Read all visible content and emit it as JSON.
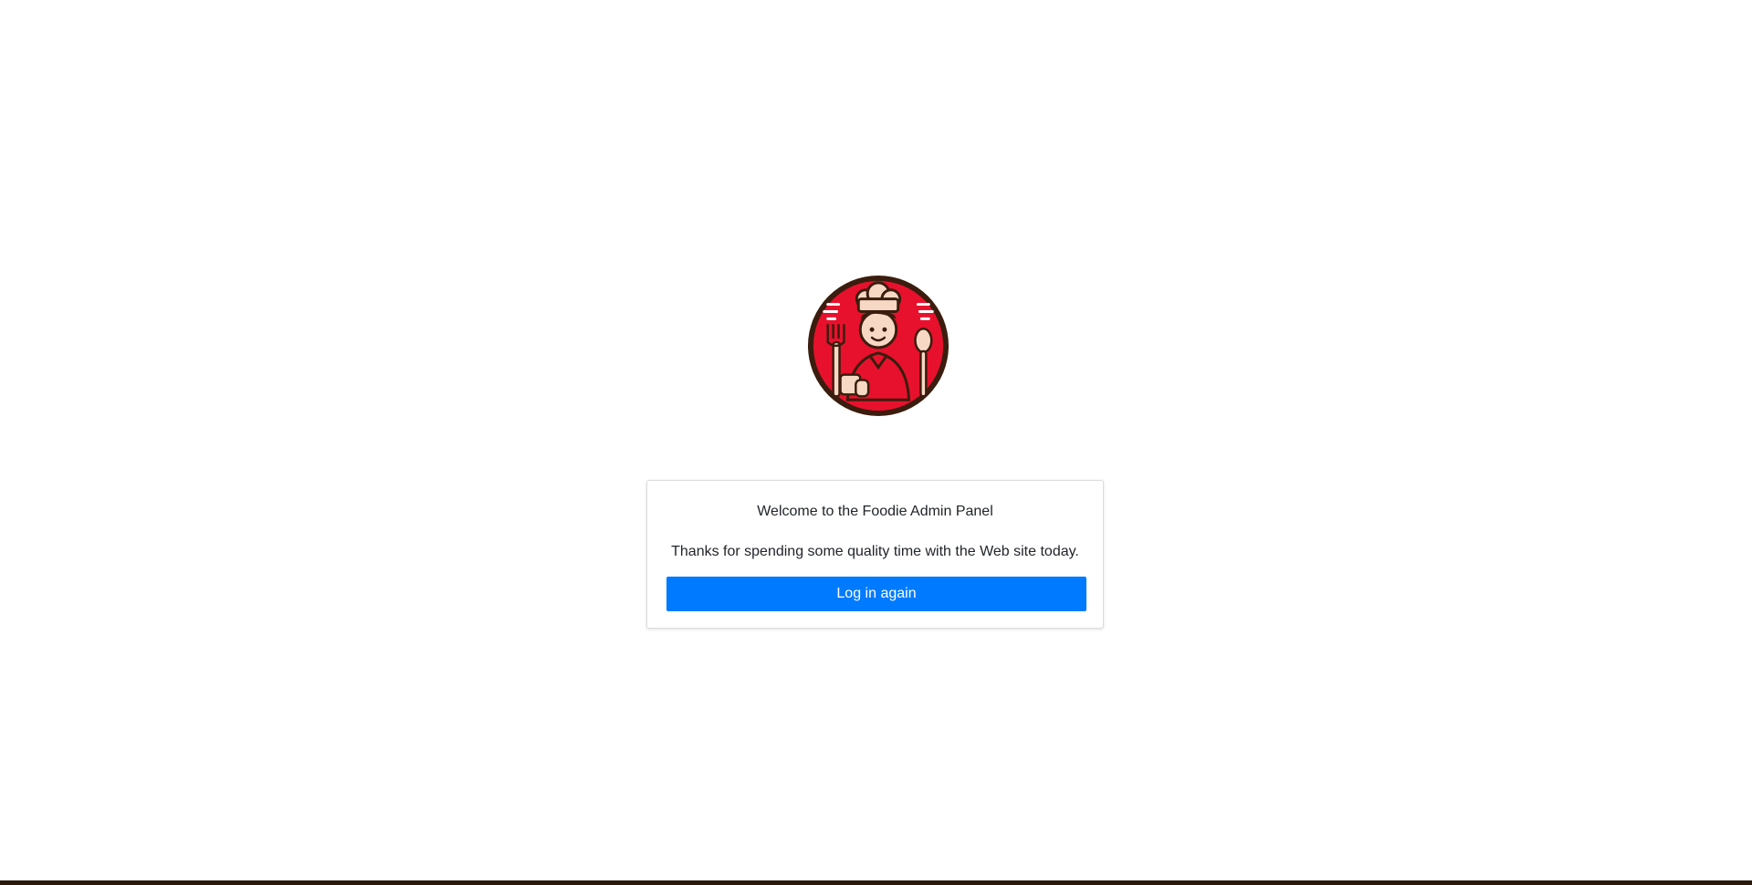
{
  "logo": {
    "icon": "chef-mascot-logo",
    "colors": {
      "ring": "#3a1d0e",
      "fill": "#e8112d",
      "accent": "#f7d8c4"
    }
  },
  "card": {
    "welcome_text": "Welcome to the Foodie Admin Panel",
    "thanks_text": "Thanks for spending some quality time with the Web site today.",
    "login_button_label": "Log in again"
  },
  "theme": {
    "button_color": "#007bff",
    "footer_bar_color": "#2b1a0b"
  }
}
